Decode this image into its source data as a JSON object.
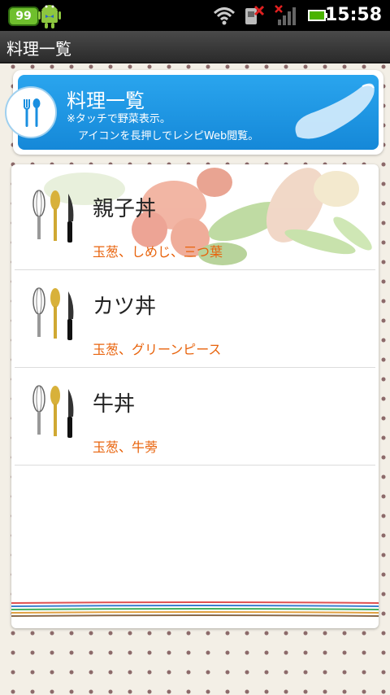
{
  "status_bar": {
    "notification_count": "99",
    "time": "15:58"
  },
  "title_bar": {
    "title": "料理一覧"
  },
  "banner": {
    "title": "料理一覧",
    "line1": "※タッチで野菜表示。",
    "line2": "アイコンを長押しでレシピWeb閲覧。",
    "accent_color": "#1a93e0"
  },
  "recipes": [
    {
      "name": "親子丼",
      "ingredients": "玉葱、しめじ、三つ葉"
    },
    {
      "name": "カツ丼",
      "ingredients": "玉葱、グリーンピース"
    },
    {
      "name": "牛丼",
      "ingredients": "玉葱、牛蒡"
    }
  ],
  "colors": {
    "ingredient_text": "#e8630c",
    "background": "#f3efe6",
    "dot": "#8c6a6a"
  }
}
